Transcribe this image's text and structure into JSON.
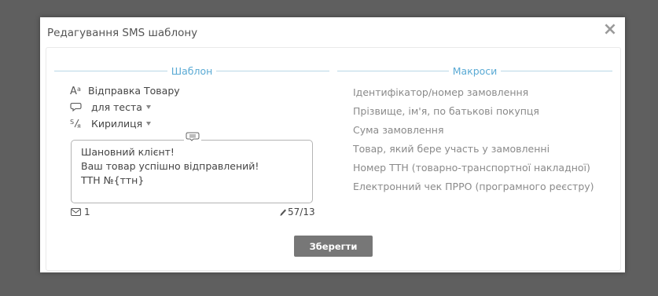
{
  "dialog": {
    "title": "Редагування SMS шаблону",
    "close_symbol": "×"
  },
  "template": {
    "section_title": "Шаблон",
    "name": "Відправка Товару",
    "name_icon": "font-size-icon",
    "category": "для теста",
    "category_icon": "chat-bubble-icon",
    "alphabet": "Кирилиця",
    "alphabet_icon": "transliteration-icon",
    "message_lines": [
      "Шановний клієнт!",
      "Ваш товар успішно відправлений!",
      "ТТН №{ттн}"
    ],
    "sms_count": "1",
    "char_counter": "57/13"
  },
  "macros": {
    "section_title": "Макроси",
    "items": [
      "Ідентифікатор/номер замовлення",
      "Прізвище, ім'я, по батькові покупця",
      "Сума замовлення",
      "Товар, який бере участь у замовленні",
      "Номер ТТН (товарно-транспортної накладної)",
      "Електронний чек ПРРО (програмного реєстру)"
    ]
  },
  "actions": {
    "save_label": "Зберегти"
  },
  "colors": {
    "accent": "#5aaad4",
    "backdrop": "#5f5f5f",
    "button": "#777777"
  }
}
